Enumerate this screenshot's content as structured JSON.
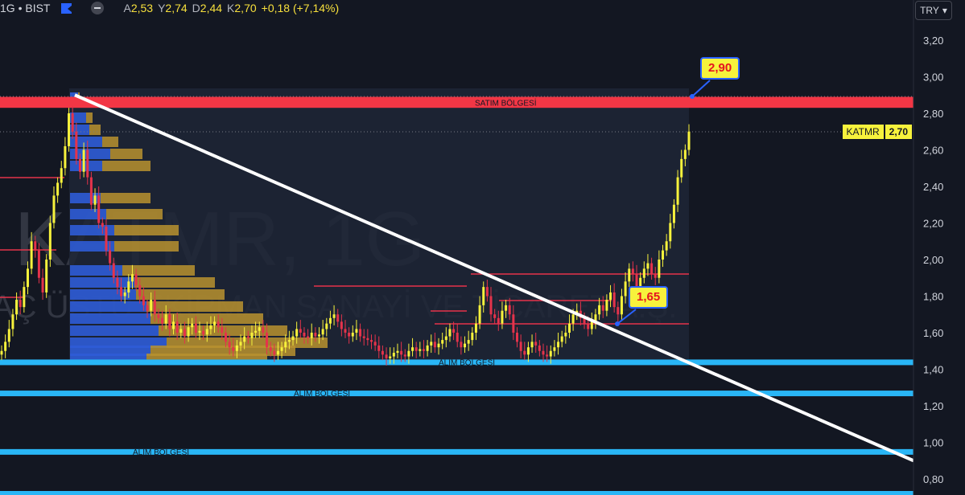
{
  "header": {
    "symbol": "1G • BIST",
    "ohlc": [
      {
        "key": "A",
        "value": "2,53"
      },
      {
        "key": "Y",
        "value": "2,74"
      },
      {
        "key": "D",
        "value": "2,44"
      },
      {
        "key": "K",
        "value": "2,70"
      }
    ],
    "change": "+0,18 (+7,14%)",
    "currency": "TRY"
  },
  "watermark": {
    "ticker": "KATMR, 1G",
    "company": "AÇ ÜSTÜ EKİPMAN SANAYİ VE TİCARET A.Ş."
  },
  "annotations": {
    "callout_high": "2,90",
    "callout_low": "1,65",
    "sell_zone_label": "SATIM BÖLGESİ",
    "buy_zone_labels": [
      "ALIM BÖLGESİ",
      "ALIM BÖLGESİ",
      "ALIM BÖLGESİ"
    ],
    "price_tag_symbol": "KATMR",
    "price_tag_value": "2,70"
  },
  "colors": {
    "background": "#131722",
    "up": "#f7f23c",
    "down": "#e5334b",
    "sell_zone": "#f23645",
    "buy_zone": "#29b6f6",
    "trendline": "#ffffff",
    "volume_profile_up": "#2f5cd6",
    "volume_profile_down": "#b8922f"
  },
  "chart_data": {
    "type": "candlestick",
    "yaxis_ticks": [
      "3,20",
      "3,00",
      "2,80",
      "2,60",
      "2,40",
      "2,20",
      "2,00",
      "1,80",
      "1,60",
      "1,40",
      "1,20",
      "1,00",
      "0,80"
    ],
    "ylim": [
      0.72,
      3.28
    ],
    "last_price": 2.7,
    "zones": [
      {
        "label": "SATIM BÖLGESİ",
        "from": 2.83,
        "to": 2.89,
        "kind": "sell"
      },
      {
        "label": "ALIM BÖLGESİ",
        "value": 1.44,
        "kind": "buy"
      },
      {
        "label": "ALIM BÖLGESİ",
        "value": 1.27,
        "kind": "buy"
      },
      {
        "label": "ALIM BÖLGESİ",
        "value": 0.95,
        "kind": "buy"
      }
    ],
    "resistance_lines": [
      2.45,
      2.05,
      1.8,
      1.85,
      1.92,
      1.65,
      1.72,
      1.78
    ],
    "trendline": {
      "from": 2.9,
      "to": 0.9
    },
    "close_series": [
      1.5,
      1.55,
      1.62,
      1.7,
      1.78,
      1.74,
      1.85,
      1.95,
      2.1,
      2.05,
      1.9,
      1.82,
      2.0,
      2.2,
      2.35,
      2.42,
      2.5,
      2.62,
      2.8,
      2.7,
      2.55,
      2.48,
      2.6,
      2.45,
      2.3,
      2.35,
      2.2,
      2.18,
      2.05,
      1.98,
      1.9,
      1.85,
      1.8,
      1.82,
      1.88,
      1.92,
      1.86,
      1.8,
      1.75,
      1.72,
      1.78,
      1.7,
      1.68,
      1.65,
      1.7,
      1.62,
      1.66,
      1.6,
      1.62,
      1.58,
      1.63,
      1.65,
      1.6,
      1.61,
      1.59,
      1.62,
      1.64,
      1.66,
      1.63,
      1.6,
      1.55,
      1.52,
      1.5,
      1.53,
      1.55,
      1.58,
      1.57,
      1.6,
      1.61,
      1.63,
      1.6,
      1.52,
      1.5,
      1.48,
      1.5,
      1.52,
      1.55,
      1.56,
      1.58,
      1.62,
      1.6,
      1.58,
      1.57,
      1.6,
      1.58,
      1.59,
      1.62,
      1.65,
      1.68,
      1.7,
      1.66,
      1.62,
      1.6,
      1.58,
      1.6,
      1.62,
      1.58,
      1.57,
      1.56,
      1.55,
      1.53,
      1.5,
      1.48,
      1.46,
      1.47,
      1.49,
      1.5,
      1.48,
      1.47,
      1.5,
      1.52,
      1.5,
      1.51,
      1.5,
      1.53,
      1.55,
      1.52,
      1.54,
      1.56,
      1.58,
      1.62,
      1.6,
      1.55,
      1.52,
      1.54,
      1.56,
      1.6,
      1.65,
      1.75,
      1.85,
      1.8,
      1.7,
      1.68,
      1.65,
      1.72,
      1.75,
      1.7,
      1.6,
      1.55,
      1.5,
      1.48,
      1.52,
      1.55,
      1.53,
      1.5,
      1.48,
      1.47,
      1.5,
      1.52,
      1.55,
      1.58,
      1.6,
      1.65,
      1.7,
      1.72,
      1.68,
      1.65,
      1.62,
      1.66,
      1.7,
      1.75,
      1.72,
      1.78,
      1.82,
      1.74,
      1.7,
      1.8,
      1.88,
      1.95,
      1.92,
      1.85,
      1.9,
      1.95,
      1.98,
      1.92,
      1.9,
      2.0,
      2.05,
      2.1,
      2.2,
      2.3,
      2.45,
      2.55,
      2.6,
      2.7
    ]
  }
}
